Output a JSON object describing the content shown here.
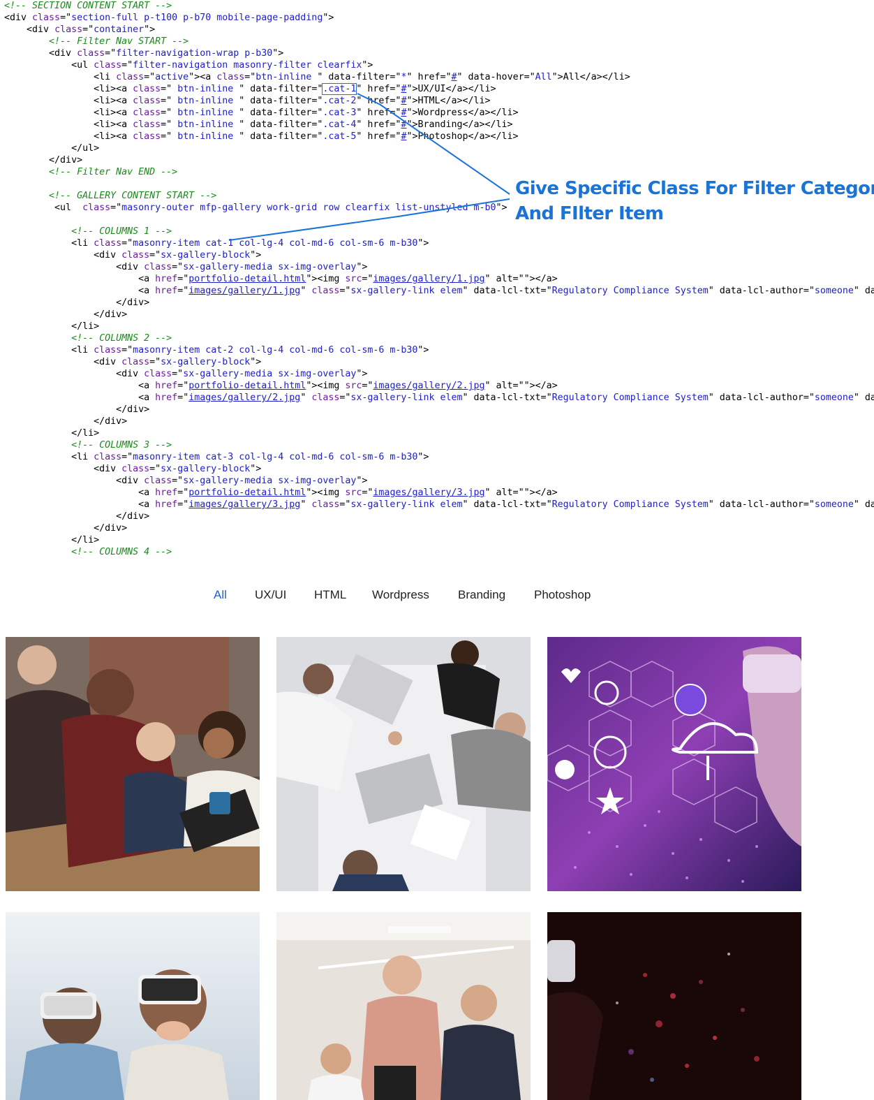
{
  "code_lines": [
    [
      {
        "t": "<!-- SECTION CONTENT START -->",
        "c": "c"
      }
    ],
    [
      {
        "t": "<div "
      },
      {
        "t": "class",
        "c": "a"
      },
      {
        "t": "=\""
      },
      {
        "t": "section-full p-t100 p-b70 mobile-page-padding",
        "c": "v"
      },
      {
        "t": "\">"
      }
    ],
    [
      {
        "t": "    <div "
      },
      {
        "t": "class",
        "c": "a"
      },
      {
        "t": "=\""
      },
      {
        "t": "container",
        "c": "v"
      },
      {
        "t": "\">"
      }
    ],
    [
      {
        "t": "        "
      },
      {
        "t": "<!-- Filter Nav START -->",
        "c": "c"
      }
    ],
    [
      {
        "t": "        <div "
      },
      {
        "t": "class",
        "c": "a"
      },
      {
        "t": "=\""
      },
      {
        "t": "filter-navigation-wrap p-b30",
        "c": "v"
      },
      {
        "t": "\">"
      }
    ],
    [
      {
        "t": "            <ul "
      },
      {
        "t": "class",
        "c": "a"
      },
      {
        "t": "=\""
      },
      {
        "t": "filter-navigation masonry-filter clearfix",
        "c": "v"
      },
      {
        "t": "\">"
      }
    ],
    [
      {
        "t": "                <li "
      },
      {
        "t": "class",
        "c": "a"
      },
      {
        "t": "=\""
      },
      {
        "t": "active",
        "c": "v"
      },
      {
        "t": "\"><a "
      },
      {
        "t": "class",
        "c": "a"
      },
      {
        "t": "=\""
      },
      {
        "t": "btn-inline ",
        "c": "v"
      },
      {
        "t": "\" data-filter=\""
      },
      {
        "t": "*",
        "c": "v"
      },
      {
        "t": "\" href=\""
      },
      {
        "t": "#",
        "c": "u"
      },
      {
        "t": "\" data-hover=\""
      },
      {
        "t": "All",
        "c": "v"
      },
      {
        "t": "\">All</a></li>"
      }
    ],
    [
      {
        "t": "                <li><a "
      },
      {
        "t": "class",
        "c": "a"
      },
      {
        "t": "=\" "
      },
      {
        "t": "btn-inline",
        "c": "v"
      },
      {
        "t": " \" data-filter=\""
      },
      {
        "t": ".cat-1",
        "c": "v hl"
      },
      {
        "t": "\" href=\""
      },
      {
        "t": "#",
        "c": "u"
      },
      {
        "t": "\">UX/UI</a></li>"
      }
    ],
    [
      {
        "t": "                <li><a "
      },
      {
        "t": "class",
        "c": "a"
      },
      {
        "t": "=\" "
      },
      {
        "t": "btn-inline",
        "c": "v"
      },
      {
        "t": " \" data-filter=\""
      },
      {
        "t": ".cat-2",
        "c": "v"
      },
      {
        "t": "\" href=\""
      },
      {
        "t": "#",
        "c": "u"
      },
      {
        "t": "\">HTML</a></li>"
      }
    ],
    [
      {
        "t": "                <li><a "
      },
      {
        "t": "class",
        "c": "a"
      },
      {
        "t": "=\" "
      },
      {
        "t": "btn-inline",
        "c": "v"
      },
      {
        "t": " \" data-filter=\""
      },
      {
        "t": ".cat-3",
        "c": "v"
      },
      {
        "t": "\" href=\""
      },
      {
        "t": "#",
        "c": "u"
      },
      {
        "t": "\">Wordpress</a></li>"
      }
    ],
    [
      {
        "t": "                <li><a "
      },
      {
        "t": "class",
        "c": "a"
      },
      {
        "t": "=\" "
      },
      {
        "t": "btn-inline",
        "c": "v"
      },
      {
        "t": " \" data-filter=\""
      },
      {
        "t": ".cat-4",
        "c": "v"
      },
      {
        "t": "\" href=\""
      },
      {
        "t": "#",
        "c": "u"
      },
      {
        "t": "\">Branding</a></li>"
      }
    ],
    [
      {
        "t": "                <li><a "
      },
      {
        "t": "class",
        "c": "a"
      },
      {
        "t": "=\" "
      },
      {
        "t": "btn-inline",
        "c": "v"
      },
      {
        "t": " \" data-filter=\""
      },
      {
        "t": ".cat-5",
        "c": "v"
      },
      {
        "t": "\" href=\""
      },
      {
        "t": "#",
        "c": "u"
      },
      {
        "t": "\">Photoshop</a></li>"
      }
    ],
    [
      {
        "t": "            </ul>"
      }
    ],
    [
      {
        "t": "        </div>"
      }
    ],
    [
      {
        "t": "        "
      },
      {
        "t": "<!-- Filter Nav END -->",
        "c": "c"
      }
    ],
    [
      {
        "t": ""
      }
    ],
    [
      {
        "t": "        "
      },
      {
        "t": "<!-- GALLERY CONTENT START -->",
        "c": "c"
      }
    ],
    [
      {
        "t": "         <ul  "
      },
      {
        "t": "class",
        "c": "a"
      },
      {
        "t": "=\""
      },
      {
        "t": "masonry-outer mfp-gallery work-grid row clearfix list-unstyled m-b0",
        "c": "v"
      },
      {
        "t": "\">"
      }
    ],
    [
      {
        "t": ""
      }
    ],
    [
      {
        "t": "            "
      },
      {
        "t": "<!-- COLUMNS 1 -->",
        "c": "c"
      }
    ],
    [
      {
        "t": "            <li "
      },
      {
        "t": "class",
        "c": "a"
      },
      {
        "t": "=\""
      },
      {
        "t": "masonry-item cat-1 col-lg-4 col-md-6 col-sm-6 m-b30",
        "c": "v"
      },
      {
        "t": "\">"
      }
    ],
    [
      {
        "t": "                <div "
      },
      {
        "t": "class",
        "c": "a"
      },
      {
        "t": "=\""
      },
      {
        "t": "sx-gallery-block",
        "c": "v"
      },
      {
        "t": "\">"
      }
    ],
    [
      {
        "t": "                    <div "
      },
      {
        "t": "class",
        "c": "a"
      },
      {
        "t": "=\""
      },
      {
        "t": "sx-gallery-media sx-img-overlay",
        "c": "v"
      },
      {
        "t": "\">"
      }
    ],
    [
      {
        "t": "                        <a "
      },
      {
        "t": "href",
        "c": "a"
      },
      {
        "t": "=\""
      },
      {
        "t": "portfolio-detail.html",
        "c": "u"
      },
      {
        "t": "\"><img "
      },
      {
        "t": "src",
        "c": "a"
      },
      {
        "t": "=\""
      },
      {
        "t": "images/gallery/1.jpg",
        "c": "u"
      },
      {
        "t": "\" alt=\"\"></a>"
      }
    ],
    [
      {
        "t": "                        <a "
      },
      {
        "t": "href",
        "c": "a"
      },
      {
        "t": "=\""
      },
      {
        "t": "images/gallery/1.jpg",
        "c": "u"
      },
      {
        "t": "\" "
      },
      {
        "t": "class",
        "c": "a"
      },
      {
        "t": "=\""
      },
      {
        "t": "sx-gallery-link elem",
        "c": "v"
      },
      {
        "t": "\" data-lcl-txt=\""
      },
      {
        "t": "Regulatory Compliance System",
        "c": "v"
      },
      {
        "t": "\" data-lcl-author=\""
      },
      {
        "t": "someone",
        "c": "v"
      },
      {
        "t": "\" da"
      }
    ],
    [
      {
        "t": "                    </div>"
      }
    ],
    [
      {
        "t": "                </div>"
      }
    ],
    [
      {
        "t": "            </li>"
      }
    ],
    [
      {
        "t": "            "
      },
      {
        "t": "<!-- COLUMNS 2 -->",
        "c": "c"
      }
    ],
    [
      {
        "t": "            <li "
      },
      {
        "t": "class",
        "c": "a"
      },
      {
        "t": "=\""
      },
      {
        "t": "masonry-item cat-2 col-lg-4 col-md-6 col-sm-6 m-b30",
        "c": "v"
      },
      {
        "t": "\">"
      }
    ],
    [
      {
        "t": "                <div "
      },
      {
        "t": "class",
        "c": "a"
      },
      {
        "t": "=\""
      },
      {
        "t": "sx-gallery-block",
        "c": "v"
      },
      {
        "t": "\">"
      }
    ],
    [
      {
        "t": "                    <div "
      },
      {
        "t": "class",
        "c": "a"
      },
      {
        "t": "=\""
      },
      {
        "t": "sx-gallery-media sx-img-overlay",
        "c": "v"
      },
      {
        "t": "\">"
      }
    ],
    [
      {
        "t": "                        <a "
      },
      {
        "t": "href",
        "c": "a"
      },
      {
        "t": "=\""
      },
      {
        "t": "portfolio-detail.html",
        "c": "u"
      },
      {
        "t": "\"><img "
      },
      {
        "t": "src",
        "c": "a"
      },
      {
        "t": "=\""
      },
      {
        "t": "images/gallery/2.jpg",
        "c": "u"
      },
      {
        "t": "\" alt=\"\"></a>"
      }
    ],
    [
      {
        "t": "                        <a "
      },
      {
        "t": "href",
        "c": "a"
      },
      {
        "t": "=\""
      },
      {
        "t": "images/gallery/2.jpg",
        "c": "u"
      },
      {
        "t": "\" "
      },
      {
        "t": "class",
        "c": "a"
      },
      {
        "t": "=\""
      },
      {
        "t": "sx-gallery-link elem",
        "c": "v"
      },
      {
        "t": "\" data-lcl-txt=\""
      },
      {
        "t": "Regulatory Compliance System",
        "c": "v"
      },
      {
        "t": "\" data-lcl-author=\""
      },
      {
        "t": "someone",
        "c": "v"
      },
      {
        "t": "\" da"
      }
    ],
    [
      {
        "t": "                    </div>"
      }
    ],
    [
      {
        "t": "                </div>"
      }
    ],
    [
      {
        "t": "            </li>"
      }
    ],
    [
      {
        "t": "            "
      },
      {
        "t": "<!-- COLUMNS 3 -->",
        "c": "c"
      }
    ],
    [
      {
        "t": "            <li "
      },
      {
        "t": "class",
        "c": "a"
      },
      {
        "t": "=\""
      },
      {
        "t": "masonry-item cat-3 col-lg-4 col-md-6 col-sm-6 m-b30",
        "c": "v"
      },
      {
        "t": "\">"
      }
    ],
    [
      {
        "t": "                <div "
      },
      {
        "t": "class",
        "c": "a"
      },
      {
        "t": "=\""
      },
      {
        "t": "sx-gallery-block",
        "c": "v"
      },
      {
        "t": "\">"
      }
    ],
    [
      {
        "t": "                    <div "
      },
      {
        "t": "class",
        "c": "a"
      },
      {
        "t": "=\""
      },
      {
        "t": "sx-gallery-media sx-img-overlay",
        "c": "v"
      },
      {
        "t": "\">"
      }
    ],
    [
      {
        "t": "                        <a "
      },
      {
        "t": "href",
        "c": "a"
      },
      {
        "t": "=\""
      },
      {
        "t": "portfolio-detail.html",
        "c": "u"
      },
      {
        "t": "\"><img "
      },
      {
        "t": "src",
        "c": "a"
      },
      {
        "t": "=\""
      },
      {
        "t": "images/gallery/3.jpg",
        "c": "u"
      },
      {
        "t": "\" alt=\"\"></a>"
      }
    ],
    [
      {
        "t": "                        <a "
      },
      {
        "t": "href",
        "c": "a"
      },
      {
        "t": "=\""
      },
      {
        "t": "images/gallery/3.jpg",
        "c": "u"
      },
      {
        "t": "\" "
      },
      {
        "t": "class",
        "c": "a"
      },
      {
        "t": "=\""
      },
      {
        "t": "sx-gallery-link elem",
        "c": "v"
      },
      {
        "t": "\" data-lcl-txt=\""
      },
      {
        "t": "Regulatory Compliance System",
        "c": "v"
      },
      {
        "t": "\" data-lcl-author=\""
      },
      {
        "t": "someone",
        "c": "v"
      },
      {
        "t": "\" da"
      }
    ],
    [
      {
        "t": "                    </div>"
      }
    ],
    [
      {
        "t": "                </div>"
      }
    ],
    [
      {
        "t": "            </li>"
      }
    ],
    [
      {
        "t": "            "
      },
      {
        "t": "<!-- COLUMNS 4 -->",
        "c": "c"
      }
    ]
  ],
  "annotation": {
    "line1": "Give Specific Class For Filter Category",
    "line2": "And FIlter Item",
    "color": "#1a73d6"
  },
  "filter_nav": {
    "items": [
      {
        "label": "All",
        "active": true
      },
      {
        "label": "UX/UI",
        "active": false
      },
      {
        "label": "HTML",
        "active": false
      },
      {
        "label": "Wordpress",
        "active": false
      },
      {
        "label": "Branding",
        "active": false
      },
      {
        "label": "Photoshop",
        "active": false
      }
    ],
    "active_color": "#1f5fd0",
    "color": "#222222"
  },
  "gallery": {
    "items": [
      {
        "subject": "team-laptop-photo",
        "theme": "warm-office"
      },
      {
        "subject": "handshake-meeting-photo",
        "theme": "bright-desk"
      },
      {
        "subject": "vr-network-icons-photo",
        "theme": "purple-tech"
      },
      {
        "subject": "kids-vr-headsets-photo",
        "theme": "light-blue"
      },
      {
        "subject": "office-team-photo",
        "theme": "light-office"
      },
      {
        "subject": "vr-particles-photo",
        "theme": "dark-red"
      }
    ]
  }
}
